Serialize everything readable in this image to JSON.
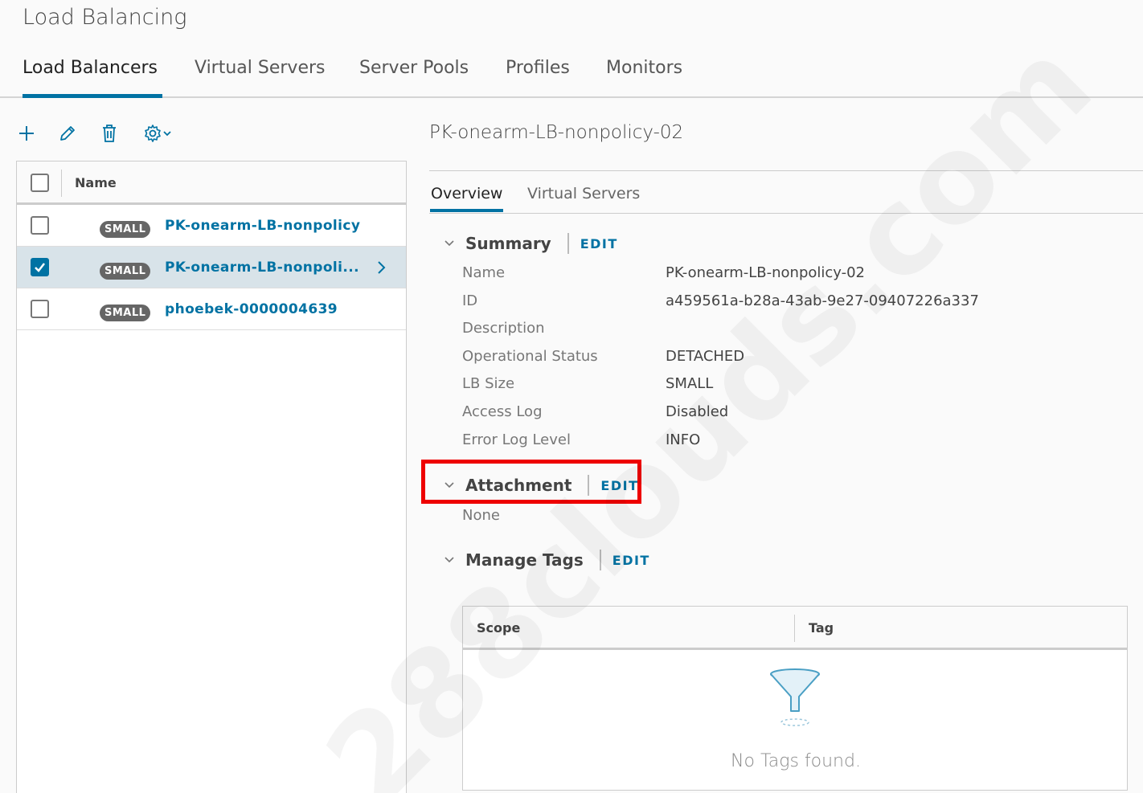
{
  "page": {
    "title": "Load Balancing"
  },
  "main_tabs": [
    {
      "label": "Load Balancers"
    },
    {
      "label": "Virtual Servers"
    },
    {
      "label": "Server Pools"
    },
    {
      "label": "Profiles"
    },
    {
      "label": "Monitors"
    }
  ],
  "active_main_tab": "Load Balancers",
  "toolbar": {
    "icons": [
      "plus-icon",
      "pencil-icon",
      "trash-icon",
      "gear-icon",
      "chevron-down-icon"
    ]
  },
  "grid": {
    "column": "Name",
    "rows": [
      {
        "size": "SMALL",
        "name": "PK-onearm-LB-nonpolicy",
        "selected": false
      },
      {
        "size": "SMALL",
        "name": "PK-onearm-LB-nonpoli...",
        "selected": true
      },
      {
        "size": "SMALL",
        "name": "phoebek-0000004639",
        "selected": false
      }
    ]
  },
  "detail": {
    "title": "PK-onearm-LB-nonpolicy-02",
    "tabs": [
      {
        "label": "Overview"
      },
      {
        "label": "Virtual Servers"
      }
    ],
    "active_tab": "Overview",
    "summary": {
      "title": "Summary",
      "edit": "EDIT",
      "props": [
        {
          "label": "Name",
          "value": "PK-onearm-LB-nonpolicy-02"
        },
        {
          "label": "ID",
          "value": "a459561a-b28a-43ab-9e27-09407226a337"
        },
        {
          "label": "Description",
          "value": ""
        },
        {
          "label": "Operational Status",
          "value": "DETACHED"
        },
        {
          "label": "LB Size",
          "value": "SMALL"
        },
        {
          "label": "Access Log",
          "value": "Disabled"
        },
        {
          "label": "Error Log Level",
          "value": "INFO"
        }
      ]
    },
    "attachment": {
      "title": "Attachment",
      "edit": "EDIT",
      "value": "None"
    },
    "tags": {
      "title": "Manage Tags",
      "edit": "EDIT",
      "columns": [
        "Scope",
        "Tag"
      ],
      "empty_text": "No Tags found."
    }
  },
  "colors": {
    "accent": "#0072a3",
    "highlight": "#e00000",
    "badge": "#666666"
  },
  "watermark": "288clouds.com"
}
